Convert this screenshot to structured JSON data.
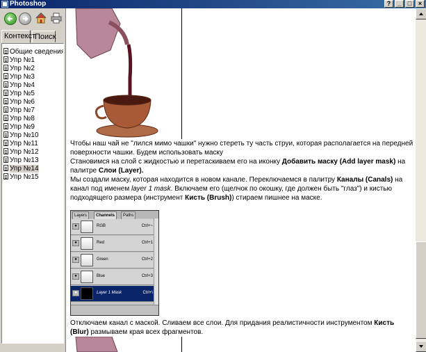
{
  "window": {
    "title": "Photoshop",
    "buttons": [
      "?",
      "_",
      "□",
      "×"
    ]
  },
  "toolbar": {
    "icons": [
      "back-arrow-icon",
      "forward-arrow-icon",
      "home-icon",
      "print-icon"
    ]
  },
  "tabs": [
    {
      "label": "Контекст"
    },
    {
      "label": "Поиск"
    }
  ],
  "tree": {
    "items": [
      {
        "label": "Общие сведения"
      },
      {
        "label": "Упр №1"
      },
      {
        "label": "Упр №2"
      },
      {
        "label": "Упр №3"
      },
      {
        "label": "Упр №4"
      },
      {
        "label": "Упр №5"
      },
      {
        "label": "Упр №6"
      },
      {
        "label": "Упр №7"
      },
      {
        "label": "Упр №8"
      },
      {
        "label": "Упр №9"
      },
      {
        "label": "Упр №10"
      },
      {
        "label": "Упр №11"
      },
      {
        "label": "Упр №12"
      },
      {
        "label": "Упр №13"
      },
      {
        "label": "Упр №14"
      },
      {
        "label": "Упр №15"
      }
    ],
    "selected_index": 14
  },
  "content": {
    "p1": "Чтобы наш чай не \"лился мимо чашки\" нужно стереть ту часть струи, которая располагается на передней поверхности чашки. Будем использовать маску",
    "p2_a": "Становимся на слой с жидкостью и перетаскиваем его на иконку ",
    "p2_b": "Добавить маску (Add layer mask)",
    "p2_c": " на палитре ",
    "p2_d": "Слои (Layer).",
    "p3_a": "Мы создали маску, которая находится в новом канале. Переключаемся в палитру ",
    "p3_b": "Каналы (Canals)",
    "p3_c": " на канал под именем ",
    "p3_d": "layer 1 mask",
    "p3_e": ". Включаем его (щелчок по окошку, где должен быть \"глаз\") и кистью подходящего размера (инструмент ",
    "p3_f": "Кисть (Brush)",
    "p3_g": ") стираем пишнее на маске.",
    "p4_a": "Отключаем канал с маской. Сливаем все слои. Для придания реалистичности инструментом ",
    "p4_b": "Кисть (Blur)",
    "p4_c": " размываем края всех фрагментов."
  },
  "channels_panel": {
    "tabs": [
      "Layers",
      "Channels",
      "Paths"
    ],
    "active_tab": "Channels",
    "rows": [
      {
        "name": "RGB",
        "shortcut": "Ctrl+~"
      },
      {
        "name": "Red",
        "shortcut": "Ctrl+1"
      },
      {
        "name": "Green",
        "shortcut": "Ctrl+2"
      },
      {
        "name": "Blue",
        "shortcut": "Ctrl+3"
      },
      {
        "name": "Layer 1 Mask",
        "shortcut": "Ctrl+\\"
      }
    ],
    "selected_row": 4
  }
}
